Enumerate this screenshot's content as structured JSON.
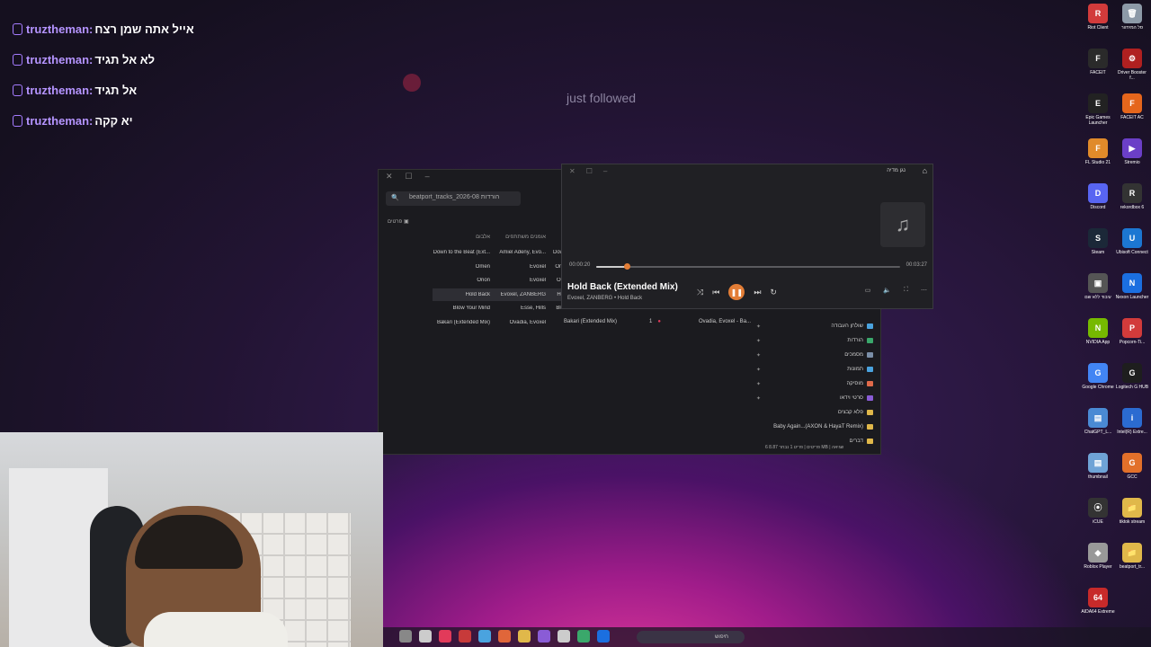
{
  "chat": {
    "messages": [
      {
        "user": "truztheman:",
        "text": "אייל אתה שמן רצח"
      },
      {
        "user": "truztheman:",
        "text": "לא אל תגיד"
      },
      {
        "user": "truztheman:",
        "text": "אל תגיד"
      },
      {
        "user": "truztheman:",
        "text": "יא קקה"
      }
    ]
  },
  "follow_alert": {
    "text": "just followed"
  },
  "explorer": {
    "address": "beatport_tracks_2026-08 הורדות",
    "details_label": "פרטים",
    "columns": [
      "אלבום",
      "אומנים משתתפים",
      ""
    ],
    "files": [
      {
        "title": "Down to the Beat (Ext...",
        "artists": "Amiel Adeny, Evo...",
        "album": "Dow"
      },
      {
        "title": "Omen",
        "artists": "Evoxel",
        "album": "Om"
      },
      {
        "title": "Orion",
        "artists": "Evoxel",
        "album": "Ori"
      },
      {
        "title": "Hold Back",
        "artists": "Evoxel, ZANBERG",
        "album": "Ho"
      },
      {
        "title": "Blow Your Mind",
        "artists": "Esse, Hills",
        "album": "Blo"
      },
      {
        "title": "Bakari (Extended Mix)",
        "artists": "Ovadia, Evoxel",
        "album": ""
      }
    ],
    "extra_row": {
      "album": "Bakari (Extended Mix)",
      "num": "1",
      "artist": "Ovadia, Evoxel - Ba..."
    },
    "nav": [
      {
        "label": "שולחן העבודה",
        "color": "#4aa3df"
      },
      {
        "label": "הורדות",
        "color": "#3aa86b"
      },
      {
        "label": "מסמכים",
        "color": "#7b8fa8"
      },
      {
        "label": "תמונות",
        "color": "#4aa3df"
      },
      {
        "label": "מוסיקה",
        "color": "#e06a4a"
      },
      {
        "label": "סרטי וידאו",
        "color": "#8a5cd6"
      },
      {
        "label": "פלא קבצים",
        "color": "#e0b84a"
      },
      {
        "label": "Baby Again...(AXON & HayaT Remix)",
        "color": "#e0b84a"
      },
      {
        "label": "דברים",
        "color": "#e0b84a"
      }
    ],
    "status": "6 פריטים | פריט 1 נבחר 8.87 MB | שגיאה"
  },
  "player": {
    "app_name": "נגן מדיה",
    "current_time": "00:00:20",
    "total_time": "00:03:27",
    "progress": 0.1,
    "title": "Hold Back (Extended Mix)",
    "artist_line": "Evoxel, ZANBERG • Hold Back",
    "accent": "#e27d36"
  },
  "desktop_icons": [
    {
      "label": "Riot Client",
      "color": "#d23b3b",
      "glyph": "R"
    },
    {
      "label": "סל המיחזור",
      "color": "#8d9aa8",
      "glyph": "🗑"
    },
    {
      "label": "FACEIT",
      "color": "#2a2a2a",
      "glyph": "F"
    },
    {
      "label": "Driver Booster f...",
      "color": "#b02020",
      "glyph": "⚙"
    },
    {
      "label": "Epic Games Launcher",
      "color": "#222",
      "glyph": "E"
    },
    {
      "label": "FACEIT AC",
      "color": "#e5661c",
      "glyph": "F"
    },
    {
      "label": "FL Studio 21",
      "color": "#e08a2a",
      "glyph": "F"
    },
    {
      "label": "Stremio",
      "color": "#6b3fc7",
      "glyph": "▶"
    },
    {
      "label": "Discord",
      "color": "#5865f2",
      "glyph": "D"
    },
    {
      "label": "rekordbox 6",
      "color": "#333",
      "glyph": "R"
    },
    {
      "label": "Steam",
      "color": "#1b2838",
      "glyph": "S"
    },
    {
      "label": "Ubisoft Connect",
      "color": "#1c77d2",
      "glyph": "U"
    },
    {
      "label": "עיבוד ללא שם",
      "color": "#555",
      "glyph": "▣"
    },
    {
      "label": "Nexon Launcher",
      "color": "#1b6fe0",
      "glyph": "N"
    },
    {
      "label": "NVIDIA App",
      "color": "#76b900",
      "glyph": "N"
    },
    {
      "label": "Popcorn-Ti...",
      "color": "#d23b3b",
      "glyph": "P"
    },
    {
      "label": "Google Chrome",
      "color": "#4285f4",
      "glyph": "G"
    },
    {
      "label": "Logitech G HUB",
      "color": "#1e1e1e",
      "glyph": "G"
    },
    {
      "label": "ChatGPT_L...",
      "color": "#4a8ad4",
      "glyph": "▤"
    },
    {
      "label": "Intel(R) Extre...",
      "color": "#2b6bd1",
      "glyph": "i"
    },
    {
      "label": "thumbnail",
      "color": "#6fa3d6",
      "glyph": "▤"
    },
    {
      "label": "GCC",
      "color": "#e2702a",
      "glyph": "G"
    },
    {
      "label": "iCUE",
      "color": "#333",
      "glyph": "⦿"
    },
    {
      "label": "tiktok stream",
      "color": "#e0b84a",
      "glyph": "📁"
    },
    {
      "label": "Roblox Player",
      "color": "#999",
      "glyph": "◆"
    },
    {
      "label": "beatport_tr...",
      "color": "#e0b84a",
      "glyph": "📁"
    },
    {
      "label": "AIDA64 Extreme",
      "color": "#c72a2a",
      "glyph": "64"
    }
  ],
  "taskbar": {
    "search_placeholder": "חיפוש"
  }
}
